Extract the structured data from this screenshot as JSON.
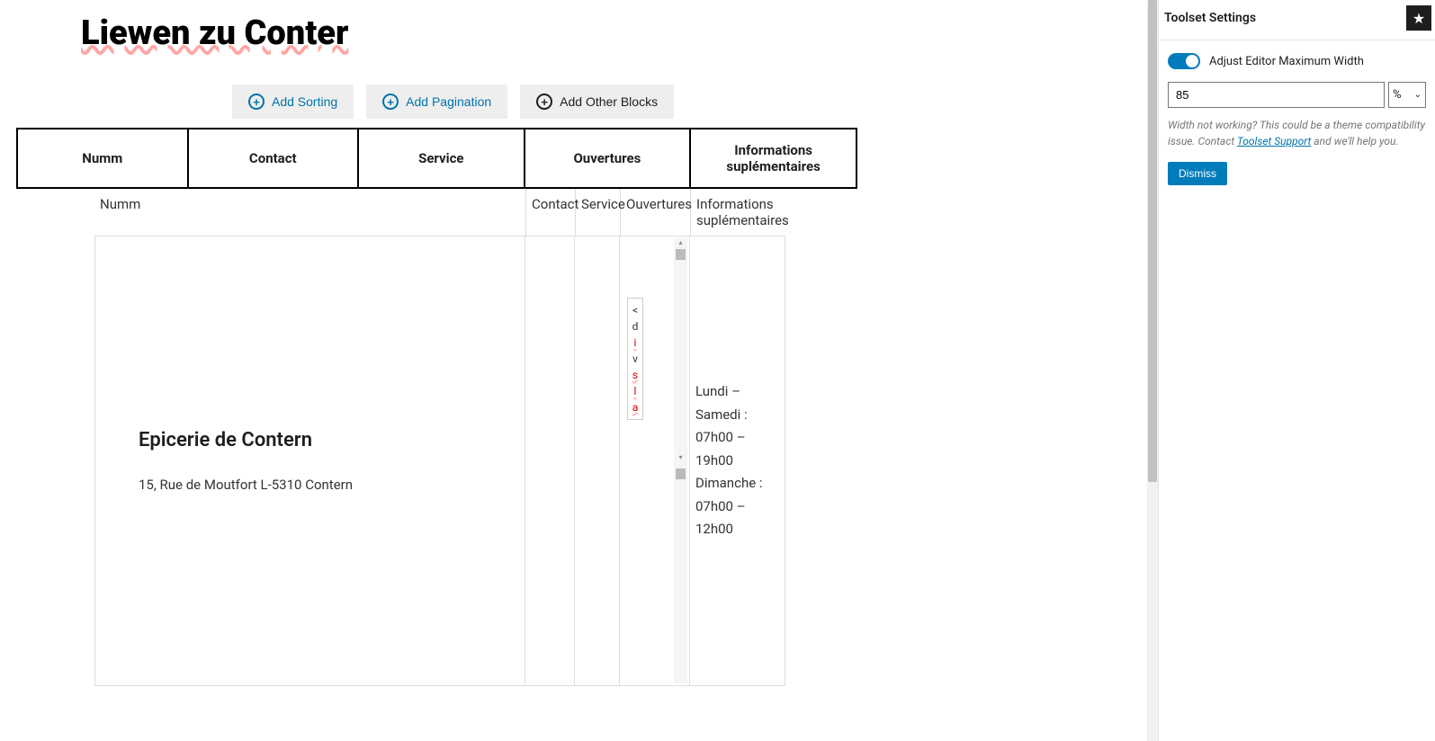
{
  "page": {
    "title": "Liewen zu Conter"
  },
  "toolbar": {
    "sorting": "Add Sorting",
    "pagination": "Add Pagination",
    "other": "Add Other Blocks"
  },
  "columns": {
    "numm": "Numm",
    "contact": "Contact",
    "service": "Service",
    "ouvertures": "Ouvertures",
    "info": "Informations suplémentaires"
  },
  "inner_headers": {
    "numm": "Numm",
    "contact": "Contact",
    "service": "Service",
    "ouvertures": "Ouvertures",
    "info": "Informations suplémentaires"
  },
  "row": {
    "name": "Epicerie de Contern",
    "address": "15, Rue de Moutfort L-5310 Contern",
    "ouv_raw": "< d i v s l a",
    "info": "Lundi – Samedi : 07h00 – 19h00 Dimanche : 07h00 – 12h00"
  },
  "sidebar": {
    "title": "Toolset Settings",
    "toggle_label": "Adjust Editor Maximum Width",
    "width_value": "85",
    "width_unit": "%",
    "help_pre": "Width not working? This could be a theme compatibility issue. Contact ",
    "help_link": "Toolset Support",
    "help_post": " and we'll help you.",
    "dismiss": "Dismiss"
  }
}
